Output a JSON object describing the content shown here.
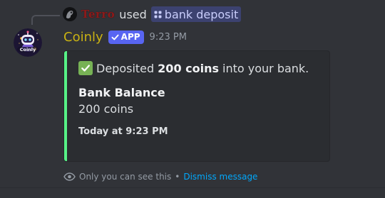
{
  "interaction": {
    "invoker_name": "Terro",
    "used_text": "used",
    "command": "bank deposit"
  },
  "message": {
    "author": "Coinly",
    "app_badge": "APP",
    "timestamp": "9:23 PM",
    "avatar_text": "Coinly",
    "name_color": "#c9b213"
  },
  "embed": {
    "accent_color": "#57f287",
    "description_prefix": "Deposited",
    "description_amount": "200 coins",
    "description_suffix": "into your bank.",
    "field_name": "Bank Balance",
    "field_value": "200 coins",
    "footer": "Today at 9:23 PM"
  },
  "ephemeral": {
    "notice": "Only you can see this",
    "separator": "•",
    "dismiss": "Dismiss message"
  },
  "icons": {
    "command": "slash-command-icon",
    "app_check": "checkmark-icon",
    "description": "white-check-mark-emoji",
    "ephemeral": "eye-icon"
  }
}
